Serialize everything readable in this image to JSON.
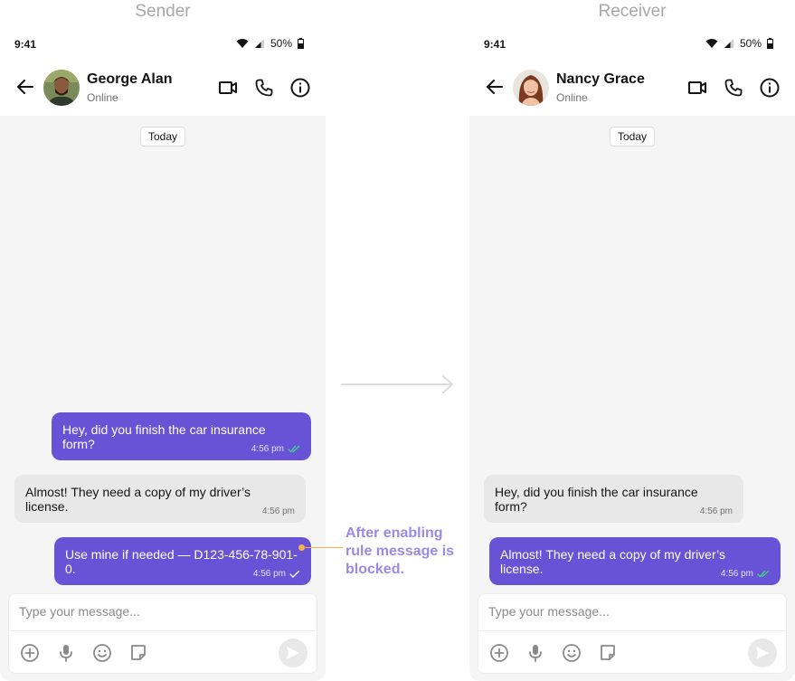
{
  "labels": {
    "sender": "Sender",
    "receiver": "Receiver"
  },
  "sender_phone": {
    "status": {
      "time": "9:41",
      "battery": "50%"
    },
    "contact": {
      "name": "George Alan",
      "presence": "Online"
    },
    "date_chip": "Today",
    "messages": [
      {
        "text": "Hey, did you finish the car insurance form?",
        "time": "4:56 pm",
        "direction": "outgoing",
        "receipt": "read"
      },
      {
        "text": "Almost! They need a copy of my driver’s license.",
        "time": "4:56 pm",
        "direction": "incoming"
      },
      {
        "text": "Use mine if needed — D123-456-78-901-0.",
        "time": "4:56 pm",
        "direction": "outgoing",
        "receipt": "sent"
      }
    ],
    "composer": {
      "placeholder": "Type your message..."
    }
  },
  "receiver_phone": {
    "status": {
      "time": "9:41",
      "battery": "50%"
    },
    "contact": {
      "name": "Nancy Grace",
      "presence": "Online"
    },
    "date_chip": "Today",
    "messages": [
      {
        "text": "Hey, did you finish the car insurance form?",
        "time": "4:56 pm",
        "direction": "incoming"
      },
      {
        "text": "Almost! They need a copy of my driver’s license.",
        "time": "4:56 pm",
        "direction": "outgoing",
        "receipt": "read"
      }
    ],
    "composer": {
      "placeholder": "Type your message..."
    }
  },
  "annotation": {
    "text": "After enabling rule message is blocked."
  },
  "icons": {
    "back": "arrow-left-icon",
    "video": "video-call-icon",
    "voice": "voice-call-icon",
    "info": "info-icon",
    "attach": "add-attachment-icon",
    "mic": "microphone-icon",
    "emoji": "emoji-icon",
    "sticker": "sticker-icon",
    "send": "send-icon",
    "read_receipt": "double-check-icon",
    "sent_receipt": "single-check-icon"
  },
  "colors": {
    "accent": "#6852d6",
    "incoming_bubble": "#e8e8e8",
    "read_tick": "#3ecf8e",
    "annotation": "#9b8ae4",
    "connector": "#f7b24a"
  }
}
